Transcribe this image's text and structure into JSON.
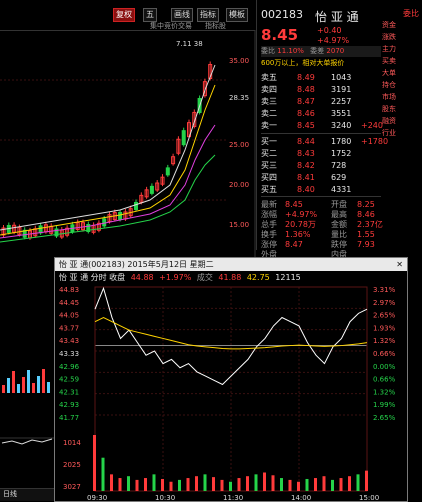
{
  "top": {
    "tabs": [
      "复权",
      "五",
      "画线",
      "指标",
      "模板"
    ],
    "active_tab": 0,
    "code": "002183",
    "name": "怡 亚 通",
    "right_label": "委比",
    "sub_labels": [
      "集中竞价交易",
      "指标股"
    ]
  },
  "quote": {
    "price": "8.45",
    "change": "+0.40",
    "pct": "+4.97%",
    "weibi_label": "委比",
    "weibi": "11.10%",
    "weicha_label": "委差",
    "weicha": "2070",
    "notice": "600万以上，相对大单报价",
    "asks": [
      {
        "label": "卖五",
        "price": "8.49",
        "vol": "1043"
      },
      {
        "label": "卖四",
        "price": "8.48",
        "vol": "3191"
      },
      {
        "label": "卖三",
        "price": "8.47",
        "vol": "2257"
      },
      {
        "label": "卖二",
        "price": "8.46",
        "vol": "3551"
      },
      {
        "label": "卖一",
        "price": "8.45",
        "vol": "3240",
        "extra": "+240"
      }
    ],
    "bids": [
      {
        "label": "买一",
        "price": "8.44",
        "vol": "1780",
        "extra": "+1780"
      },
      {
        "label": "买二",
        "price": "8.43",
        "vol": "1752"
      },
      {
        "label": "买三",
        "price": "8.42",
        "vol": "728"
      },
      {
        "label": "买四",
        "price": "8.41",
        "vol": "629"
      },
      {
        "label": "买五",
        "price": "8.40",
        "vol": "4331"
      }
    ],
    "stats": [
      {
        "l": "最新",
        "v": "8.45",
        "l2": "开盘",
        "v2": "8.25"
      },
      {
        "l": "涨幅",
        "v": "+4.97%",
        "l2": "最高",
        "v2": "8.46"
      },
      {
        "l": "总手",
        "v": "20.78万",
        "l2": "金额",
        "v2": "2.37亿"
      },
      {
        "l": "换手",
        "v": "1.36%",
        "l2": "量比",
        "v2": "1.55"
      },
      {
        "l": "涨停",
        "v": "8.47",
        "l2": "跌停",
        "v2": "7.93"
      },
      {
        "l": "外盘",
        "v": "",
        "l2": "内盘",
        "v2": ""
      }
    ]
  },
  "side": {
    "items": [
      "资金",
      "涨跌",
      "主力",
      "买卖",
      "大单",
      "持仓",
      "市场",
      "股东",
      "融资",
      "行业"
    ]
  },
  "kline": {
    "price_ticks": [
      "35.00",
      "28.35",
      "25.00",
      "20.00",
      "15.00"
    ],
    "peak_label": "7.11 38"
  },
  "popup": {
    "title": "怡 亚 通(002183) 2015年5月12日 星期二",
    "info_label": "怡 亚 通 分时 收盘",
    "info_price": "44.88",
    "info_change": "+1.97%",
    "info_vol_label": "成交",
    "info_vol": "41.88",
    "info_avg": "42.75",
    "info_num": "12115",
    "y_ticks": [
      "44.83",
      "44.45",
      "44.05",
      "43.77",
      "43.43",
      "43.33",
      "42.96",
      "42.59",
      "42.31",
      "42.93",
      "41.77"
    ],
    "pct_ticks": [
      "3.31%",
      "2.97%",
      "2.65%",
      "1.93%",
      "1.32%",
      "0.66%",
      "0.00%",
      "0.66%",
      "1.32%",
      "1.99%",
      "2.65%"
    ],
    "vol_ticks": [
      "3027",
      "2025",
      "1014"
    ],
    "time_ticks": [
      "09:30",
      "10:30",
      "11:30",
      "14:00",
      "15:00"
    ],
    "chart_data": {
      "type": "line",
      "series": [
        {
          "name": "",
          "values": [
            44.3,
            44.8,
            44.1,
            43.6,
            43.8,
            43.5,
            43.2,
            43.3,
            43.0,
            43.1,
            42.9,
            43.0,
            42.8,
            42.7,
            42.6,
            42.5,
            42.7,
            42.9,
            43.1,
            43.4,
            43.6,
            43.9,
            44.1,
            44.0,
            43.9,
            43.5,
            43.2,
            43.0,
            43.4,
            43.6,
            44.0,
            44.2,
            44.3
          ]
        },
        {
          "name": "",
          "values": [
            44.0,
            44.1,
            44.0,
            43.9,
            43.8,
            43.75,
            43.7,
            43.65,
            43.6,
            43.55,
            43.5,
            43.45,
            43.42,
            43.4,
            43.38,
            43.36,
            43.35,
            43.35,
            43.36,
            43.37,
            43.38,
            43.4,
            43.42,
            43.43,
            43.44,
            43.43,
            43.42,
            43.41,
            43.42,
            43.43,
            43.45,
            43.47,
            43.5
          ]
        }
      ],
      "volumes": [
        3027,
        1800,
        900,
        700,
        800,
        600,
        700,
        900,
        650,
        500,
        600,
        700,
        800,
        900,
        750,
        600,
        500,
        700,
        800,
        900,
        1000,
        850,
        700,
        600,
        500,
        650,
        700,
        800,
        600,
        700,
        800,
        900,
        1100
      ],
      "ylim": [
        41.77,
        44.83
      ],
      "vol_max": 3027
    }
  },
  "bottom": {
    "label": "日线"
  }
}
